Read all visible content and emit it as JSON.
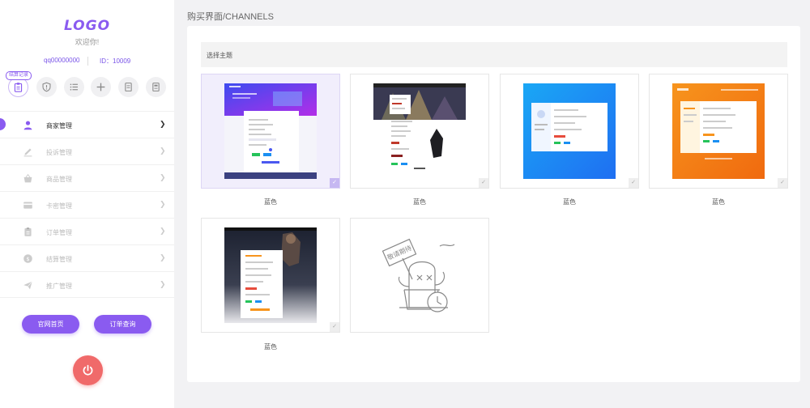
{
  "sidebar": {
    "logo": "LOGO",
    "welcome": "欢迎你!",
    "qq": "qq00000000",
    "id": "ID：10009",
    "quick_badge": "结算记录",
    "quick_icons": [
      "clipboard-icon",
      "shield-icon",
      "list-icon",
      "plus-icon",
      "document-icon",
      "receipt-icon"
    ],
    "menu": [
      {
        "label": "商家管理",
        "icon": "person-icon",
        "active": true
      },
      {
        "label": "投诉管理",
        "icon": "pencil-icon",
        "active": false
      },
      {
        "label": "商品管理",
        "icon": "basket-icon",
        "active": false
      },
      {
        "label": "卡密管理",
        "icon": "card-icon",
        "active": false
      },
      {
        "label": "订单管理",
        "icon": "clipboard-icon",
        "active": false
      },
      {
        "label": "结算管理",
        "icon": "coin-icon",
        "active": false
      },
      {
        "label": "推广管理",
        "icon": "paper-plane-icon",
        "active": false
      }
    ],
    "home_button": "官网首页",
    "order_button": "订单查询",
    "power_icon": "power-icon"
  },
  "main": {
    "breadcrumb": "购买界面/CHANNELS",
    "section_title": "选择主题",
    "themes": [
      {
        "caption": "蓝色",
        "style": "purple-gradient",
        "selected": true
      },
      {
        "caption": "蓝色",
        "style": "game-dark",
        "selected": false
      },
      {
        "caption": "蓝色",
        "style": "blue",
        "selected": false
      },
      {
        "caption": "蓝色",
        "style": "orange",
        "selected": false
      },
      {
        "caption": "蓝色",
        "style": "dark-hero",
        "selected": false
      },
      {
        "caption": "",
        "style": "placeholder",
        "placeholder_text": "敬请期待",
        "selected": false
      }
    ]
  },
  "colors": {
    "accent": "#8a5bf0",
    "power": "#f06a6a"
  }
}
